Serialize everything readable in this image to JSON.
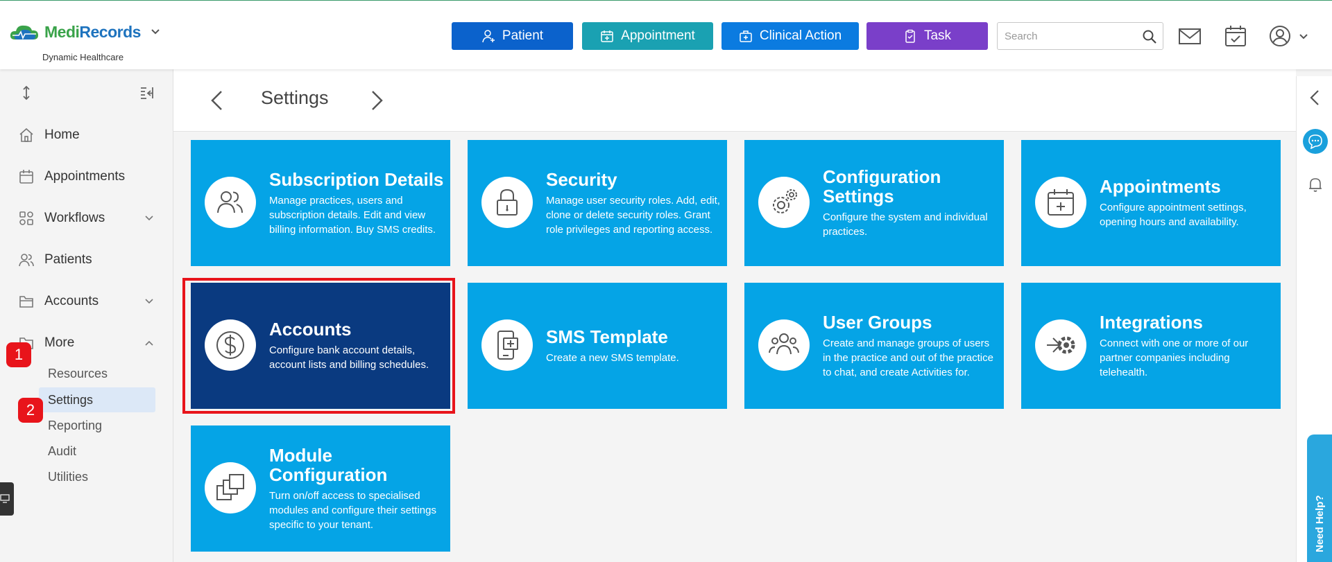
{
  "header": {
    "brand_medi": "Medi",
    "brand_records": "Records",
    "brand_sub": "Dynamic Healthcare",
    "buttons": {
      "patient": "Patient",
      "appointment": "Appointment",
      "clinical_action": "Clinical Action",
      "task": "Task"
    },
    "search_placeholder": "Search"
  },
  "sidebar": {
    "items": [
      {
        "label": "Home"
      },
      {
        "label": "Appointments"
      },
      {
        "label": "Workflows"
      },
      {
        "label": "Patients"
      },
      {
        "label": "Accounts"
      },
      {
        "label": "More"
      }
    ],
    "more_sub": [
      {
        "label": "Resources"
      },
      {
        "label": "Settings"
      },
      {
        "label": "Reporting"
      },
      {
        "label": "Audit"
      },
      {
        "label": "Utilities"
      }
    ],
    "badges": [
      "1",
      "2"
    ]
  },
  "page": {
    "title": "Settings"
  },
  "tiles": [
    {
      "title": "Subscription Details",
      "desc": "Manage practices, users and subscription details. Edit and view billing information. Buy SMS credits."
    },
    {
      "title": "Security",
      "desc": "Manage user security roles. Add, edit, clone or delete security roles. Grant role privileges and reporting access."
    },
    {
      "title": "Configuration Settings",
      "desc": "Configure the system and individual practices."
    },
    {
      "title": "Appointments",
      "desc": "Configure appointment settings, opening hours and availability."
    },
    {
      "title": "Accounts",
      "desc": "Configure bank account details, account lists and billing schedules."
    },
    {
      "title": "SMS Template",
      "desc": "Create a new SMS template."
    },
    {
      "title": "User Groups",
      "desc": "Create and manage groups of users in the practice and out of the practice to chat, and create Activities for."
    },
    {
      "title": "Integrations",
      "desc": "Connect with one or more of our partner companies including telehealth."
    },
    {
      "title": "Module Configuration",
      "desc": "Turn on/off access to specialised modules and configure their settings specific to your tenant."
    }
  ],
  "help": {
    "label": "Need Help?"
  },
  "colors": {
    "tile": "#05a4e6",
    "tile_selected": "#0a3a80",
    "highlight": "#e8141b"
  }
}
